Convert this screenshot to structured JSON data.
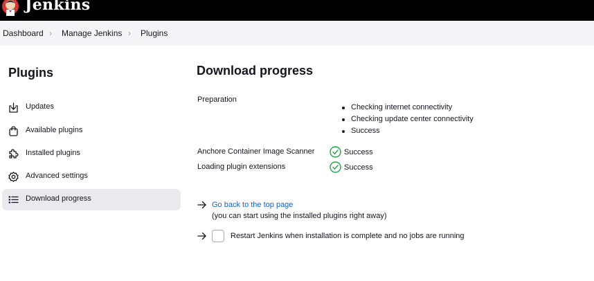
{
  "header": {
    "brand": "Jenkins",
    "logo": "jenkins-butler-logo"
  },
  "breadcrumb": {
    "items": [
      "Dashboard",
      "Manage Jenkins",
      "Plugins"
    ],
    "separator_icon": "chevron-right-icon"
  },
  "sidebar": {
    "title": "Plugins",
    "items": [
      {
        "label": "Updates",
        "icon": "download-tray-icon"
      },
      {
        "label": "Available plugins",
        "icon": "shopping-bag-icon"
      },
      {
        "label": "Installed plugins",
        "icon": "puzzle-piece-icon"
      },
      {
        "label": "Advanced settings",
        "icon": "gear-icon"
      },
      {
        "label": "Download progress",
        "icon": "list-icon",
        "active": true
      }
    ]
  },
  "main": {
    "title": "Download progress",
    "preparation": {
      "label": "Preparation",
      "steps": [
        "Checking internet connectivity",
        "Checking update center connectivity",
        "Success"
      ]
    },
    "statuses": [
      {
        "name": "Anchore Container Image Scanner",
        "status": "Success"
      },
      {
        "name": "Loading plugin extensions",
        "status": "Success"
      }
    ],
    "back_link": "Go back to the top page",
    "back_hint": "(you can start using the installed plugins right away)",
    "restart_label": "Restart Jenkins when installation is complete and no jobs are running",
    "restart_checked": false
  },
  "colors": {
    "success": "#1ea446",
    "link": "#1463c7",
    "active_nav": "#e9e9ee"
  }
}
